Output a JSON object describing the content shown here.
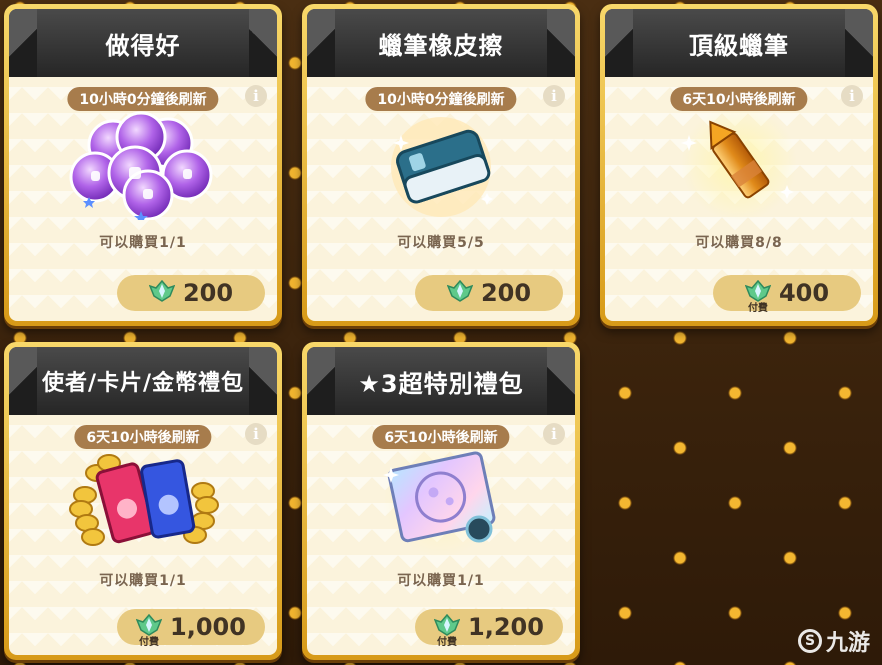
{
  "shop": {
    "items": [
      {
        "title": "做得好",
        "timer": "10小時0分鐘後刷新",
        "limit": "可以購買1/1",
        "price": "200",
        "paid_tag": "",
        "art_icon": "thumbs-up-medals-icon"
      },
      {
        "title": "蠟筆橡皮擦",
        "timer": "10小時0分鐘後刷新",
        "limit": "可以購買5/5",
        "price": "200",
        "paid_tag": "",
        "art_icon": "eraser-icon"
      },
      {
        "title": "頂級蠟筆",
        "timer": "6天10小時後刷新",
        "limit": "可以購買8/8",
        "price": "400",
        "paid_tag": "付費",
        "art_icon": "golden-crayon-icon"
      },
      {
        "title": "使者/卡片/金幣禮包",
        "timer": "6天10小時後刷新",
        "limit": "可以購買1/1",
        "price": "1,000",
        "paid_tag": "付費",
        "art_icon": "tickets-and-coins-icon"
      },
      {
        "title": "★3超特別禮包",
        "timer": "6天10小時後刷新",
        "limit": "可以購買1/1",
        "price": "1,200",
        "paid_tag": "付費",
        "art_icon": "special-card-icon"
      }
    ],
    "info_glyph": "i"
  },
  "watermark": {
    "text": "九游",
    "glyph": "S"
  },
  "colors": {
    "card_frame": "#e9b93a",
    "title_bar": "#333333",
    "timer_pill": "#a77c4c",
    "price_pill": "#e7ca80",
    "gem_green": "#5fc98a"
  }
}
